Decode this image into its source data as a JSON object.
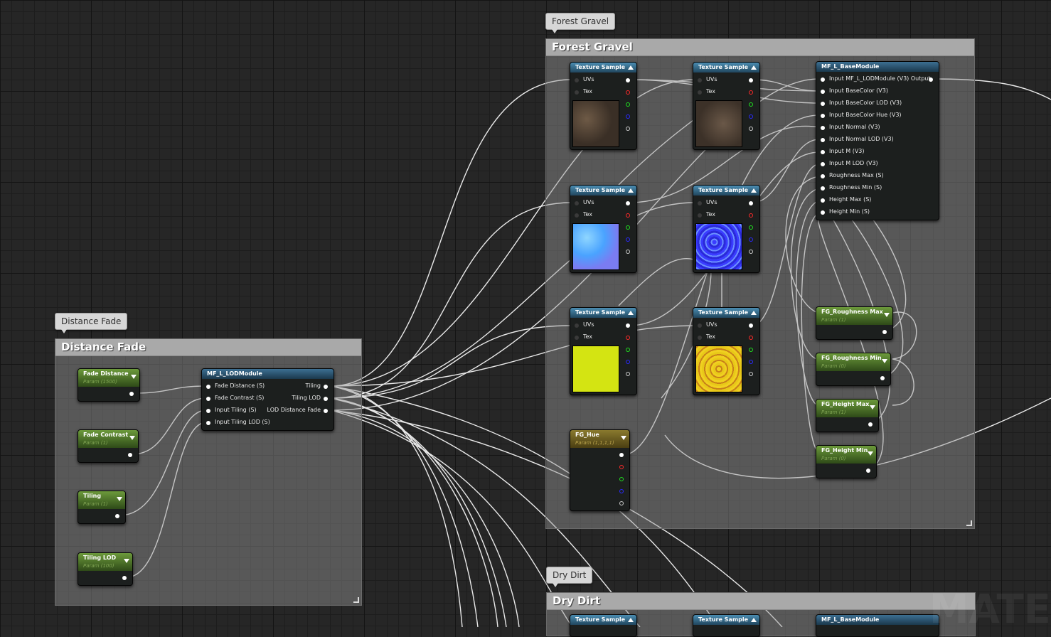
{
  "comments": {
    "forest_bubble": "Forest Gravel",
    "forest_title": "Forest Gravel",
    "distance_bubble": "Distance Fade",
    "distance_title": "Distance Fade",
    "dry_bubble": "Dry Dirt",
    "dry_title": "Dry Dirt"
  },
  "texture_node": {
    "title": "Texture Sample",
    "uvs": "UVs",
    "tex": "Tex"
  },
  "base_module": {
    "title": "MF_L_BaseModule",
    "inputs": [
      "Input MF_L_LODModule (V3) Output",
      "Input BaseColor (V3)",
      "Input BaseColor LOD (V3)",
      "Input BaseColor Hue (V3)",
      "Input Normal (V3)",
      "Input Normal LOD (V3)",
      "Input M (V3)",
      "Input M LOD (V3)",
      "Roughness Max (S)",
      "Roughness Min (S)",
      "Height Max (S)",
      "Height Min (S)"
    ]
  },
  "lod_module": {
    "title": "MF_L_LODModule",
    "inputs": [
      "Fade Distance (S)",
      "Fade Contrast (S)",
      "Input Tiling (S)",
      "Input Tiling LOD (S)"
    ],
    "outputs": [
      "Tiling",
      "Tiling LOD",
      "LOD Distance Fade"
    ]
  },
  "params": {
    "fade_distance": {
      "name": "Fade Distance",
      "value": "Param (1500)"
    },
    "fade_contrast": {
      "name": "Fade Contrast",
      "value": "Param (1)"
    },
    "tiling": {
      "name": "Tiling",
      "value": "Param (1)"
    },
    "tiling_lod": {
      "name": "Tiling LOD",
      "value": "Param (100)"
    },
    "fg_rough_max": {
      "name": "FG_Roughness Max",
      "value": "Param (1)"
    },
    "fg_rough_min": {
      "name": "FG_Roughness Min",
      "value": "Param (0)"
    },
    "fg_height_max": {
      "name": "FG_Height Max",
      "value": "Param (1)"
    },
    "fg_height_min": {
      "name": "FG_Height Min",
      "value": "Param (0)"
    },
    "fg_hue": {
      "name": "FG_Hue",
      "value": "Param (1,1,1,1)"
    }
  },
  "watermark": "MATE",
  "colors": {
    "texture_header": "#2f6a8c",
    "param_header": "#4b7226",
    "vector_header": "#7a6a22",
    "comment_title": "#a9a9a9"
  }
}
